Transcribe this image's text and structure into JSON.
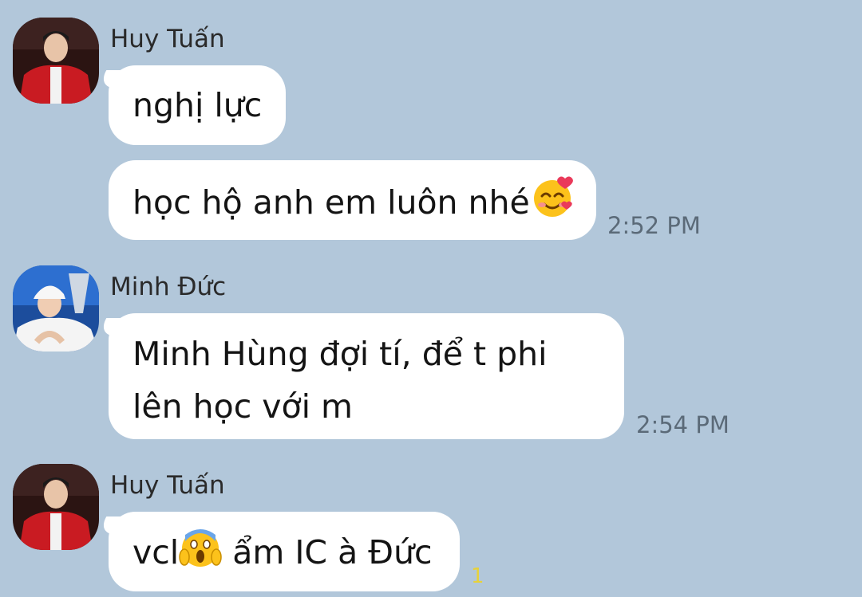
{
  "messages": [
    {
      "sender": "Huy Tuấn",
      "avatar": "avatar-huy-tuan",
      "bubbles": [
        {
          "text": "nghị lực"
        },
        {
          "text_before": "học hộ anh em luôn nhé",
          "emoji": "smiling-face-with-hearts-icon",
          "text_after": "",
          "time": "2:52 PM"
        }
      ]
    },
    {
      "sender": "Minh Đức",
      "avatar": "avatar-minh-duc",
      "bubbles": [
        {
          "line1": "Minh Hùng đợi tí, để t phi",
          "line2": "lên học với m",
          "time": "2:54 PM"
        }
      ]
    },
    {
      "sender": "Huy Tuấn",
      "avatar": "avatar-huy-tuan",
      "bubbles": [
        {
          "text_before": "vcl",
          "emoji": "face-screaming-in-fear-icon",
          "text_after": " ẩm IC à Đức",
          "unread": "1"
        }
      ]
    }
  ],
  "colors": {
    "background": "#b2c7da",
    "bubble": "#ffffff",
    "unread": "#e7d23a"
  }
}
